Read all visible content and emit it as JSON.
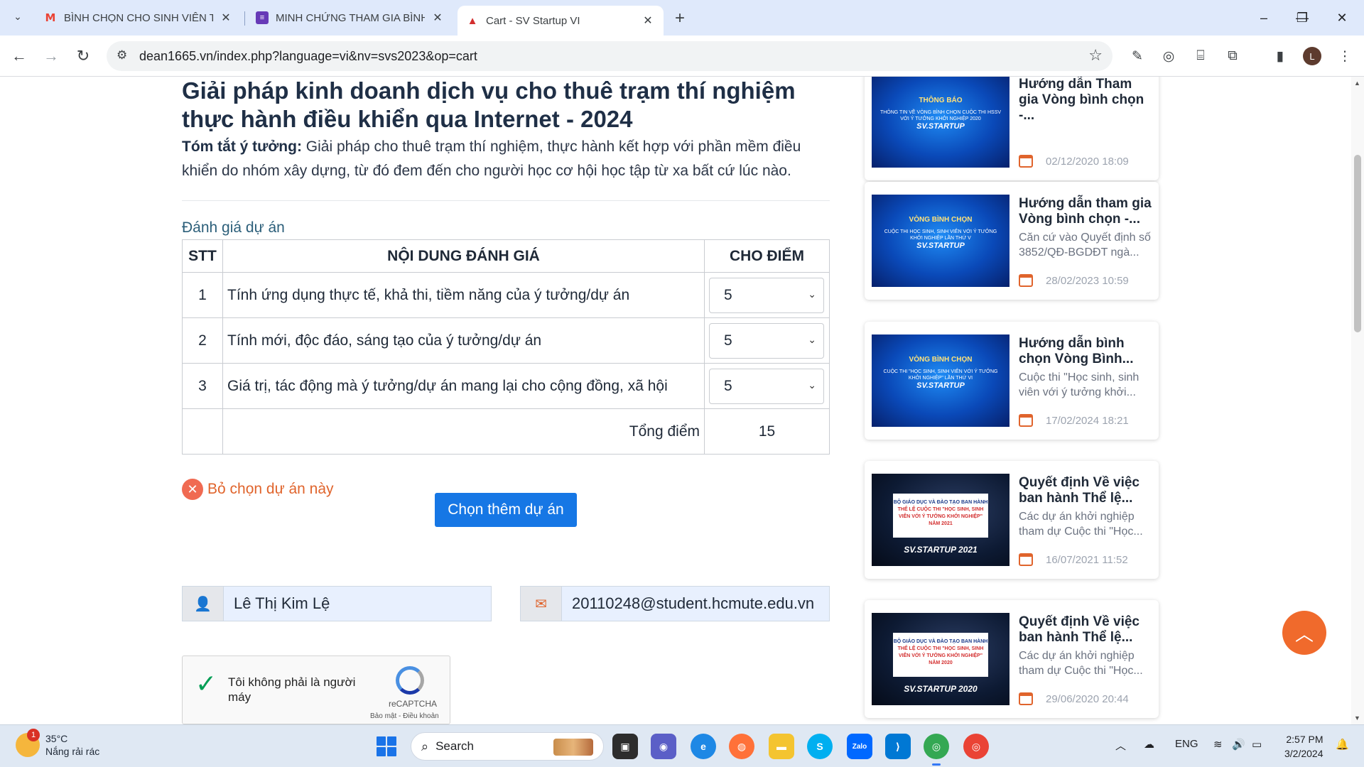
{
  "browser": {
    "tabs": [
      {
        "title": "BÌNH CHỌN CHO SINH VIÊN TP",
        "favicon": "gmail-icon",
        "active": false
      },
      {
        "title": "MINH CHỨNG THAM GIA BÌNH",
        "favicon": "forms-icon",
        "active": false
      },
      {
        "title": "Cart - SV Startup VI",
        "favicon": "cart-icon",
        "active": true
      }
    ],
    "url": "dean1665.vn/index.php?language=vi&nv=svs2023&op=cart",
    "profile_initial": "L"
  },
  "project": {
    "title": "Giải pháp kinh doanh dịch vụ cho thuê trạm thí nghiệm thực hành điều khiển qua Internet - 2024",
    "summary_label": "Tóm tắt ý tưởng:",
    "summary_text": " Giải pháp cho thuê trạm thí nghiệm, thực hành kết hợp với phần mềm điều khiển do nhóm xây dựng, từ đó đem đến cho người học cơ hội học tập từ xa bất cứ lúc nào."
  },
  "evaluation": {
    "label": "Đánh giá dự án",
    "headers": {
      "stt": "STT",
      "content": "NỘI DUNG ĐÁNH GIÁ",
      "score": "CHO ĐIỂM"
    },
    "rows": [
      {
        "stt": "1",
        "content": "Tính ứng dụng thực tế, khả thi, tiềm năng của ý tưởng/dự án",
        "score": "5"
      },
      {
        "stt": "2",
        "content": "Tính mới, độc đáo, sáng tạo của ý tưởng/dự án",
        "score": "5"
      },
      {
        "stt": "3",
        "content": "Giá trị, tác động mà ý tưởng/dự án mang lại cho cộng đồng, xã hội",
        "score": "5"
      }
    ],
    "total_label": "Tổng điểm",
    "total_value": "15"
  },
  "actions": {
    "unselect_label": "Bỏ chọn dự án này",
    "choose_more_label": "Chọn thêm dự án"
  },
  "user": {
    "name": "Lê Thị Kim Lệ",
    "email": "20110248@student.hcmute.edu.vn"
  },
  "recaptcha": {
    "label": "Tôi không phải là người máy",
    "brand": "reCAPTCHA",
    "terms": "Bảo mật - Điều khoản"
  },
  "sidebar": {
    "news": [
      {
        "title": "Hướng dẫn Tham gia Vòng bình chọn -...",
        "desc": "",
        "date": "02/12/2020 18:09",
        "thumb_banner": "THÔNG BÁO",
        "thumb_sub": "THÔNG TIN VỀ VÒNG BÌNH CHỌN CUỘC THI HSSV VỚI Ý TƯỞNG KHỞI NGHIỆP 2020",
        "thumb_logo": "SV.STARTUP"
      },
      {
        "title": "Hướng dẫn tham gia Vòng bình chọn -...",
        "desc": "Căn cứ vào Quyết định số 3852/QĐ-BGDĐT ngà...",
        "date": "28/02/2023 10:59",
        "thumb_banner": "VÒNG BÌNH CHỌN",
        "thumb_sub": "CUỘC THI HỌC SINH, SINH VIÊN VỚI Ý TƯỞNG KHỞI NGHIỆP LẦN THỨ V",
        "thumb_logo": "SV.STARTUP"
      },
      {
        "title": "Hướng dẫn bình chọn Vòng Bình...",
        "desc": "Cuộc thi \"Học sinh, sinh viên với ý tưởng khởi...",
        "date": "17/02/2024 18:21",
        "thumb_banner": "VÒNG BÌNH CHỌN",
        "thumb_sub": "CUỘC THI \"HỌC SINH, SINH VIÊN VỚI Ý TƯỞNG KHỞI NGHIỆP\" LẦN THỨ VI",
        "thumb_logo": "SV.STARTUP"
      },
      {
        "title": "Quyết định Về việc ban hành Thể lệ...",
        "desc": "Các dự án khởi nghiệp tham dự Cuộc thi \"Học...",
        "date": "16/07/2021 11:52",
        "thumb_banner": "BỘ GIÁO DỤC VÀ ĐÀO TẠO BAN HÀNH",
        "thumb_sub": "THỂ LỆ CUỘC THI \"HỌC SINH, SINH VIÊN VỚI Ý TƯỞNG KHỞI NGHIỆP\" NĂM 2021",
        "thumb_logo": "SV.STARTUP 2021"
      },
      {
        "title": "Quyết định Về việc ban hành Thể lệ...",
        "desc": "Các dự án khởi nghiệp tham dự Cuộc thi \"Học...",
        "date": "29/06/2020 20:44",
        "thumb_banner": "BỘ GIÁO DỤC VÀ ĐÀO TẠO BAN HÀNH",
        "thumb_sub": "THỂ LỆ CUỘC THI \"HỌC SINH, SINH VIÊN VỚI Ý TƯỞNG KHỞI NGHIỆP\" NĂM 2020",
        "thumb_logo": "SV.STARTUP 2020"
      }
    ]
  },
  "taskbar": {
    "weather_temp": "35°C",
    "weather_desc": "Nắng rải rác",
    "weather_badge": "1",
    "search_label": "Search",
    "lang": "ENG",
    "time": "2:57 PM",
    "date": "3/2/2024"
  }
}
